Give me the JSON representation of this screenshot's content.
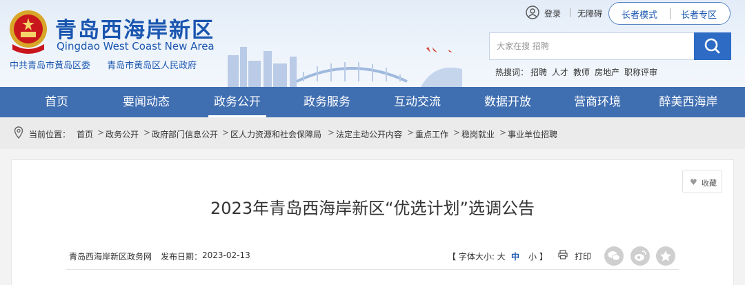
{
  "header": {
    "site_title": "青岛西海岸新区",
    "site_subtitle": "Qingdao West Coast New Area",
    "org_party": "中共青岛市黄岛区委",
    "org_gov": "青岛市黄岛区人民政府"
  },
  "top_links": {
    "login": "登录",
    "accessibility": "无障碍",
    "elder_mode": "长者模式",
    "elder_zone": "长者专区"
  },
  "search": {
    "placeholder": "大家在搜 招聘",
    "hot_label": "热搜词：",
    "hot_words": [
      "招聘",
      "人才",
      "教师",
      "房地产",
      "职称评审"
    ]
  },
  "nav": {
    "items": [
      "首页",
      "要闻动态",
      "政务公开",
      "政务服务",
      "互动交流",
      "数据开放",
      "营商环境",
      "醉美西海岸"
    ],
    "active_index": 2
  },
  "breadcrumb": {
    "label": "当前位置：",
    "items": [
      "首页",
      "政务公开",
      "政府部门信息公开",
      "区人力资源和社会保障局",
      "法定主动公开内容",
      "重点工作",
      "稳岗就业",
      "事业单位招聘"
    ]
  },
  "article": {
    "title": "2023年青岛西海岸新区“优选计划”选调公告",
    "source": "青岛西海岸新区政务网",
    "publish_label": "发布日期：",
    "publish_date": "2023-02-13",
    "font_size_label": "【 字体大小: 大",
    "font_medium": "中",
    "font_small": "小 】",
    "print_label": "打印",
    "favorite_label": "收藏"
  },
  "share_icons": [
    "wechat-icon",
    "weibo-icon",
    "qzone-icon"
  ],
  "colors": {
    "brand_blue": "#1a56b0",
    "nav_blue": "#3f6eb1",
    "search_button": "#2d6bc4",
    "active_font_blue": "#1a56b0"
  }
}
